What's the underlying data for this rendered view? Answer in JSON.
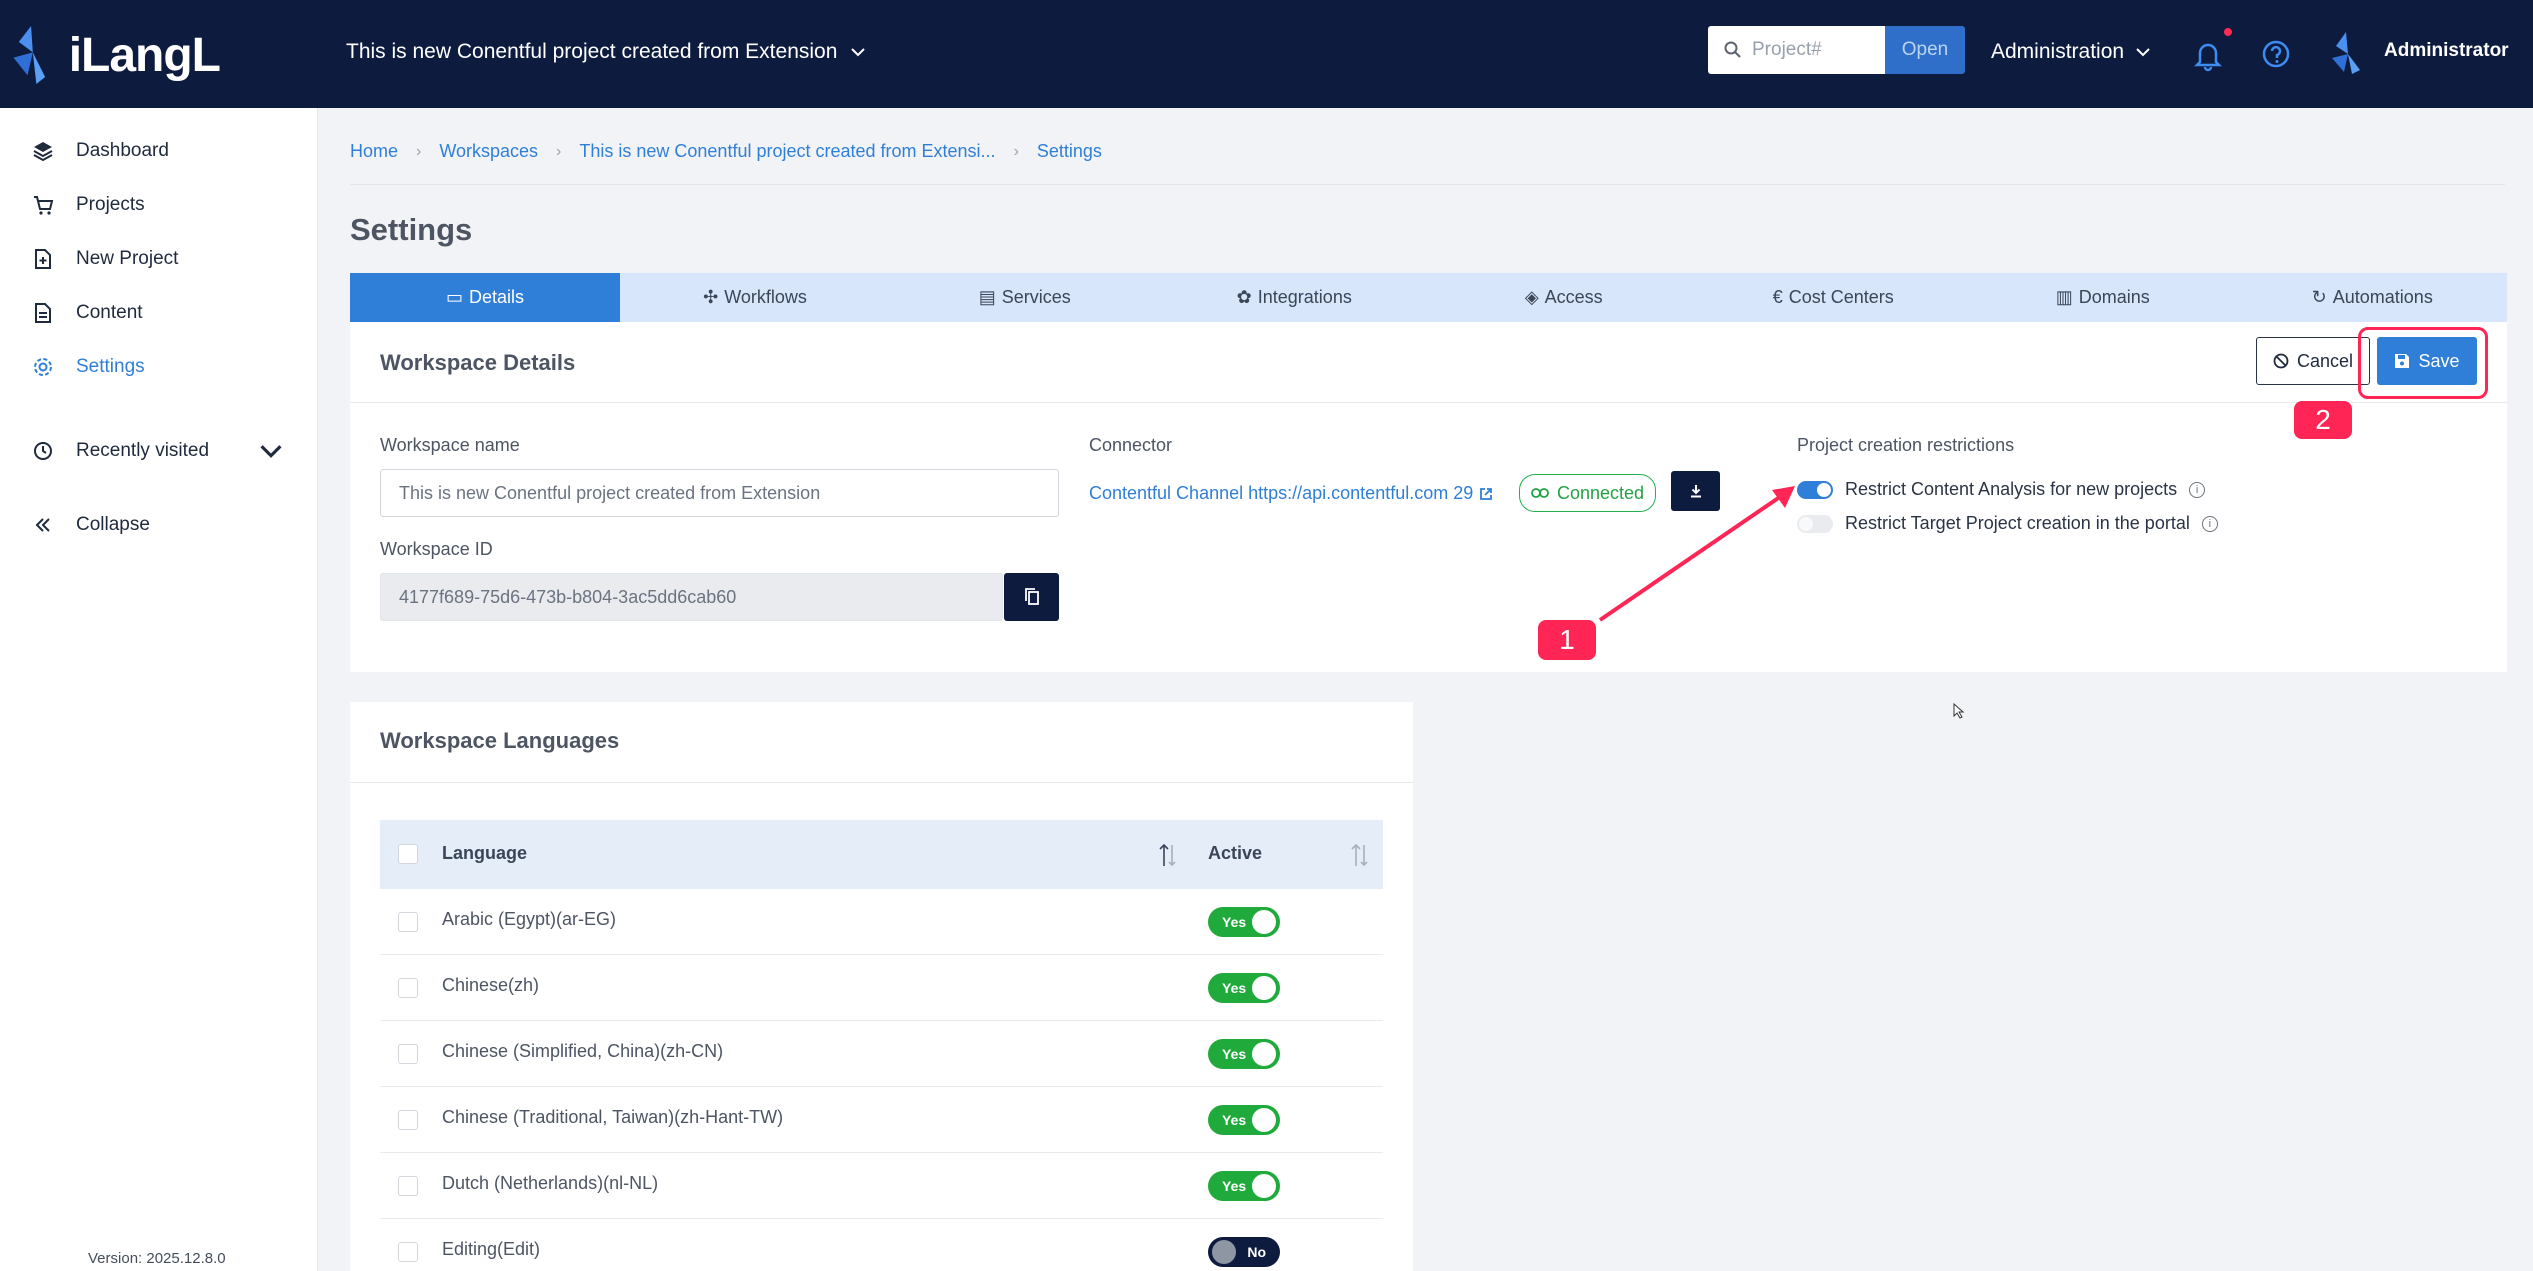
{
  "app": {
    "logo_text": "iLangL",
    "project_title": "This is new Conentful project created from Extension"
  },
  "header": {
    "search_placeholder": "Project#",
    "open_label": "Open",
    "admin_menu_label": "Administration",
    "user_name": "Administrator"
  },
  "sidebar": {
    "items": [
      {
        "label": "Dashboard",
        "icon": "layers-icon"
      },
      {
        "label": "Projects",
        "icon": "cart-icon"
      },
      {
        "label": "New Project",
        "icon": "new-file-icon"
      },
      {
        "label": "Content",
        "icon": "document-icon"
      },
      {
        "label": "Settings",
        "icon": "gear-icon"
      }
    ],
    "recently_visited": "Recently visited",
    "collapse": "Collapse",
    "version": "Version: 2025.12.8.0"
  },
  "breadcrumb": [
    "Home",
    "Workspaces",
    "This is new Conentful project created from Extensi...",
    "Settings"
  ],
  "page_title": "Settings",
  "tabs": [
    "Details",
    "Workflows",
    "Services",
    "Integrations",
    "Access",
    "Cost Centers",
    "Domains",
    "Automations"
  ],
  "details": {
    "heading": "Workspace Details",
    "cancel_label": "Cancel",
    "save_label": "Save",
    "workspace_name_label": "Workspace name",
    "workspace_name_value": "This is new Conentful project created from Extension",
    "workspace_id_label": "Workspace ID",
    "workspace_id_value": "4177f689-75d6-473b-b804-3ac5dd6cab60",
    "connector_label": "Connector",
    "connector_link": "Contentful Channel https://api.contentful.com 29",
    "connected_label": "Connected",
    "restrictions_label": "Project creation restrictions",
    "restriction_1": "Restrict Content Analysis for new projects",
    "restriction_2": "Restrict Target Project creation in the portal",
    "restriction_1_on": true,
    "restriction_2_on": false
  },
  "annotations": {
    "callout_1": "1",
    "callout_2": "2",
    "highlight_color": "#ff2555"
  },
  "languages": {
    "heading": "Workspace Languages",
    "col_language": "Language",
    "col_active": "Active",
    "rows": [
      {
        "name": "Arabic (Egypt)(ar-EG)",
        "active": "Yes"
      },
      {
        "name": "Chinese(zh)",
        "active": "Yes"
      },
      {
        "name": "Chinese (Simplified, China)(zh-CN)",
        "active": "Yes"
      },
      {
        "name": "Chinese (Traditional, Taiwan)(zh-Hant-TW)",
        "active": "Yes"
      },
      {
        "name": "Dutch (Netherlands)(nl-NL)",
        "active": "Yes"
      },
      {
        "name": "Editing(Edit)",
        "active": "No"
      }
    ]
  },
  "colors": {
    "navy": "#0d1b3e",
    "accent": "#2f7fd8",
    "green": "#1faa3b"
  }
}
